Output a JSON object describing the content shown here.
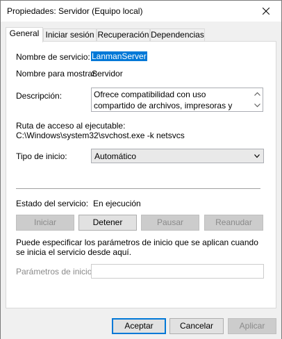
{
  "window": {
    "title": "Propiedades: Servidor (Equipo local)"
  },
  "tabs": [
    {
      "label": "General",
      "active": true
    },
    {
      "label": "Iniciar sesión",
      "active": false
    },
    {
      "label": "Recuperación",
      "active": false
    },
    {
      "label": "Dependencias",
      "active": false
    }
  ],
  "general": {
    "service_name_label": "Nombre de servicio:",
    "service_name_value": "LanmanServer",
    "display_name_label": "Nombre para mostrar:",
    "display_name_value": "Servidor",
    "description_label": "Descripción:",
    "description_value": "Ofrece compatibilidad con uso compartido de archivos, impresoras y canalizaciones con",
    "exe_path_label": "Ruta de acceso al ejecutable:",
    "exe_path_value": "C:\\Windows\\system32\\svchost.exe -k netsvcs",
    "startup_type_label": "Tipo de inicio:",
    "startup_type_value": "Automático",
    "service_status_label": "Estado del servicio:",
    "service_status_value": "En ejecución",
    "buttons": {
      "start": "Iniciar",
      "stop": "Detener",
      "pause": "Pausar",
      "resume": "Reanudar"
    },
    "start_params_help": "Puede especificar los parámetros de inicio que se aplican cuando se inicia el servicio desde aquí.",
    "start_params_label": "Parámetros de inicio:",
    "start_params_value": ""
  },
  "footer": {
    "ok": "Aceptar",
    "cancel": "Cancelar",
    "apply": "Aplicar"
  },
  "colors": {
    "accent": "#0078d7",
    "disabled_text": "#8a8a8a",
    "window_bg": "#f0f0f0"
  }
}
